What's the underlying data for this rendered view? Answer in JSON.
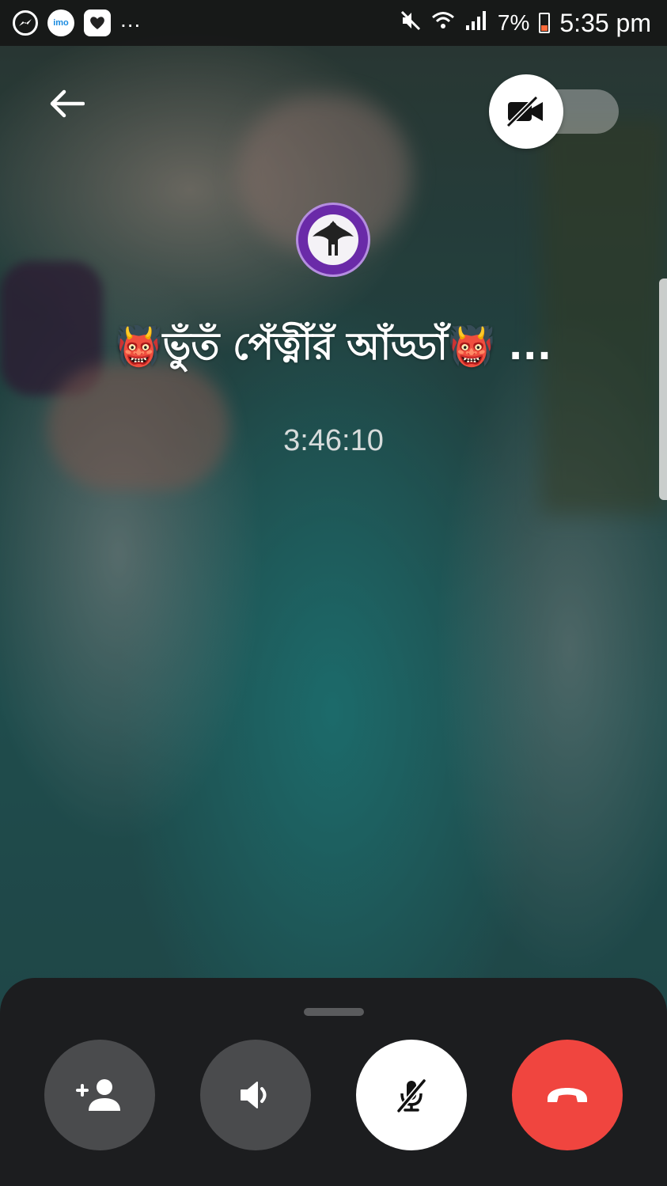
{
  "status_bar": {
    "notification_icons": [
      "messenger-icon",
      "imo-icon",
      "heart-app-icon"
    ],
    "imo_label": "imo",
    "more_indicator": "...",
    "battery_percent": "7%",
    "time": "5:35 pm",
    "battery_color": "#ff6a3a"
  },
  "call": {
    "group_name": "👹ভুঁতঁ পেঁত্নীঁরঁ আঁড্ডাঁ👹 ...",
    "duration": "3:46:10",
    "video_enabled": false
  },
  "controls": {
    "add_person_icon": "add-person-icon",
    "speaker_icon": "speaker-icon",
    "mute_icon": "mic-off-icon",
    "end_call_icon": "end-call-icon"
  },
  "colors": {
    "end_call": "#f0453f",
    "sheet_bg": "#1c1d1f",
    "secondary_button": "#4a4b4d"
  }
}
